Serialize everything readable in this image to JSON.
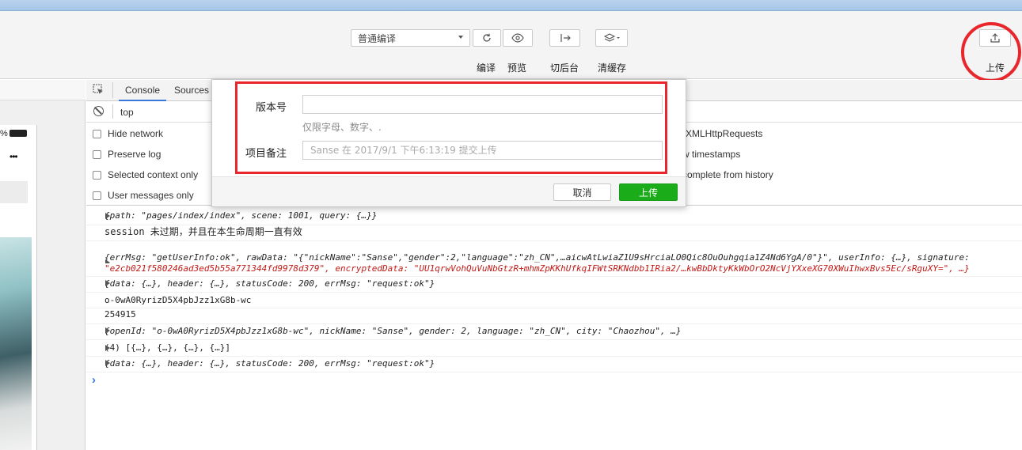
{
  "toolbar": {
    "compile_mode": "普通编译",
    "compile_label": "编译",
    "preview_label": "预览",
    "background_label": "切后台",
    "clear_cache_label": "清缓存",
    "upload_label": "上传"
  },
  "devtools": {
    "tabs": [
      "Console",
      "Sources"
    ],
    "context": "top",
    "settings_left": [
      "Hide network",
      "Preserve log",
      "Selected context only",
      "User messages only"
    ],
    "settings_right": [
      "XMLHttpRequests",
      "w timestamps",
      "complete from history"
    ]
  },
  "console": {
    "lines": [
      {
        "expand": true,
        "text": "{path: \"pages/index/index\", scene: 1001, query: {…}}"
      },
      {
        "expand": false,
        "text": "session 未过期，并且在本生命周期一直有效"
      },
      {
        "expand": true,
        "text": "{errMsg: \"getUserInfo:ok\", rawData: \"{\"nickName\":\"Sanse\",\"gender\":2,\"language\":\"zh_CN\",…aicwAtLwiaZ1U9sHrciaLO0Qic8OuOuhgqia1Z4Nd6YgA/0\"}\", userInfo: {…}, signature:"
      },
      {
        "expand": false,
        "text": "\"e2cb021f580246ad3ed5b55a771344fd9978d379\", encryptedData: \"UU1qrwVohQuVuNbGtzR+mhmZpKKhUfkqIFWtSRKNdbb1IRia2/…kwBbDktyKkWbOrO2NcVjYXxeXG70XWuIhwxBvs5Ec/sRguXY=\", …}"
      },
      {
        "expand": true,
        "text": "{data: {…}, header: {…}, statusCode: 200, errMsg: \"request:ok\"}"
      },
      {
        "expand": false,
        "text": "o-0wA0RyrizD5X4pbJzz1xG8b-wc"
      },
      {
        "expand": false,
        "text": "254915"
      },
      {
        "expand": true,
        "text": "{openId: \"o-0wA0RyrizD5X4pbJzz1xG8b-wc\", nickName: \"Sanse\", gender: 2, language: \"zh_CN\", city: \"Chaozhou\", …}"
      },
      {
        "expand": true,
        "text": "(4) [{…}, {…}, {…}, {…}]"
      },
      {
        "expand": true,
        "text": "{data: {…}, header: {…}, statusCode: 200, errMsg: \"request:ok\"}"
      }
    ],
    "prompt": "›"
  },
  "simulator": {
    "battery_text": "%",
    "menu_dots": "•••"
  },
  "upload_dialog": {
    "version_label": "版本号",
    "version_value": "",
    "version_hint": "仅限字母、数字、.",
    "note_label": "项目备注",
    "note_placeholder": "Sanse 在 2017/9/1 下午6:13:19 提交上传",
    "cancel_label": "取消",
    "confirm_label": "上传"
  },
  "colors": {
    "highlight": "#e8262b",
    "confirm": "#1aad19"
  }
}
